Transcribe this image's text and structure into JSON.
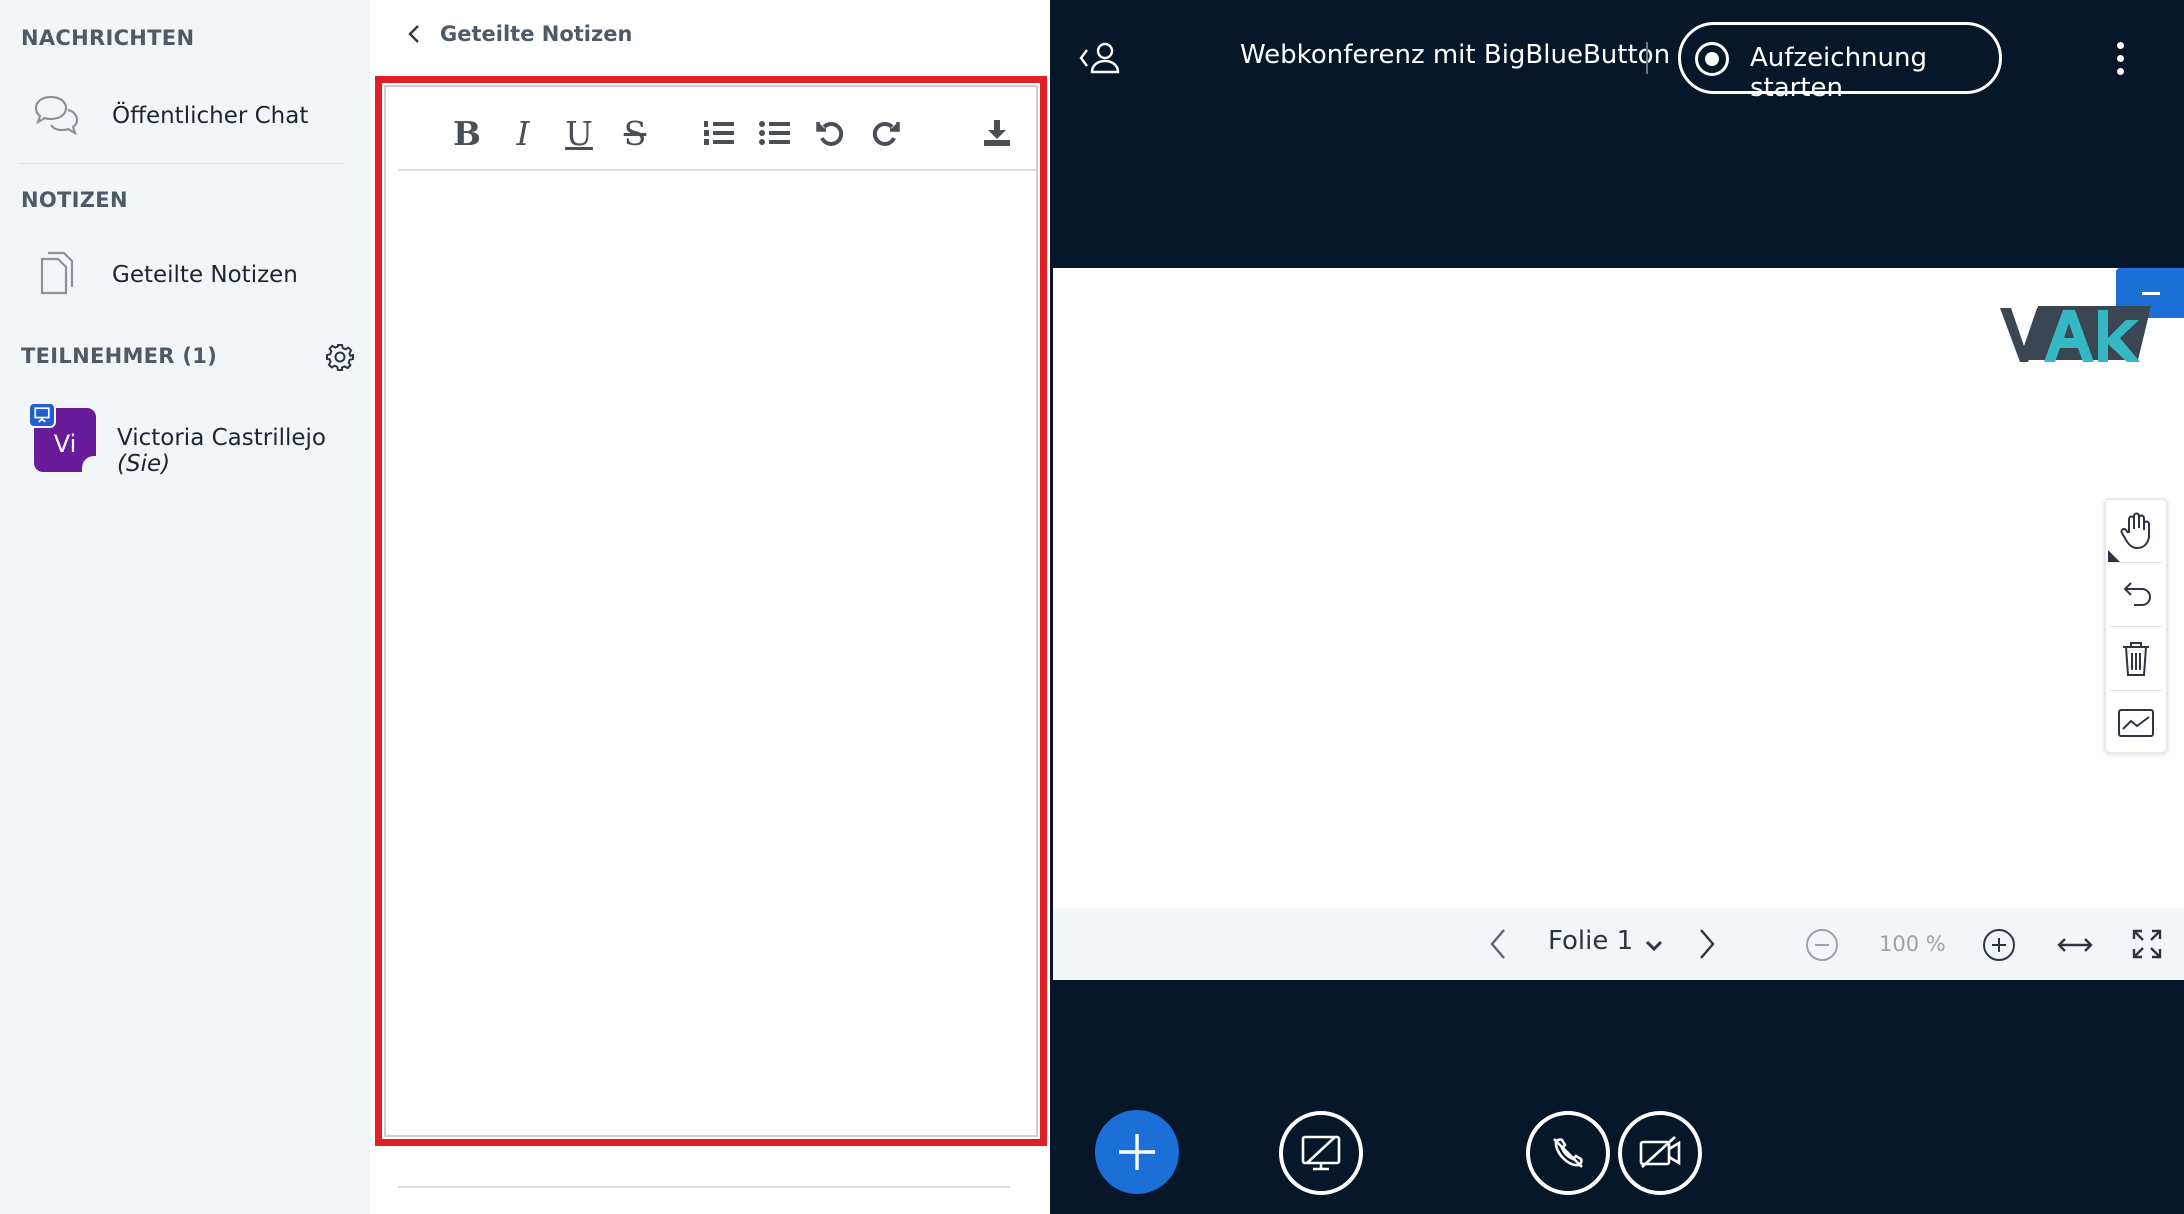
{
  "sidebar": {
    "messages_title": "NACHRICHTEN",
    "public_chat_label": "Öffentlicher Chat",
    "notes_title": "NOTIZEN",
    "shared_notes_label": "Geteilte Notizen",
    "participants_title": "TEILNEHMER (1)",
    "user": {
      "avatar_initials": "Vi",
      "name": "Victoria Castrillejo",
      "you_suffix": "(Sie)",
      "avatar_color": "#6a1b9a"
    }
  },
  "notes_panel": {
    "title": "Geteilte Notizen",
    "toolbar": {
      "bold": "B",
      "italic": "I",
      "underline": "U",
      "strikethrough": "S"
    },
    "highlight_color": "#e41e26"
  },
  "conference": {
    "meeting_title": "Webkonferenz mit BigBlueButton",
    "record_label": "Aufzeichnung starten",
    "slide": {
      "logo_text": "VAk",
      "current_slide": "Folie 1",
      "zoom_level": "100 %"
    },
    "accent_color": "#1c6fd6",
    "background_color": "#06172a"
  },
  "icons": [
    "chat-icon",
    "notes-icon",
    "gear-icon",
    "presenter-icon",
    "chevron-left-icon",
    "ordered-list-icon",
    "unordered-list-icon",
    "undo-icon",
    "redo-icon",
    "download-icon",
    "user-list-icon",
    "record-icon",
    "more-icon",
    "minimize-icon",
    "hand-icon",
    "whiteboard-undo-icon",
    "trash-icon",
    "multi-user-icon",
    "plus-icon",
    "audio-off-icon",
    "video-off-icon",
    "screenshare-off-icon"
  ]
}
